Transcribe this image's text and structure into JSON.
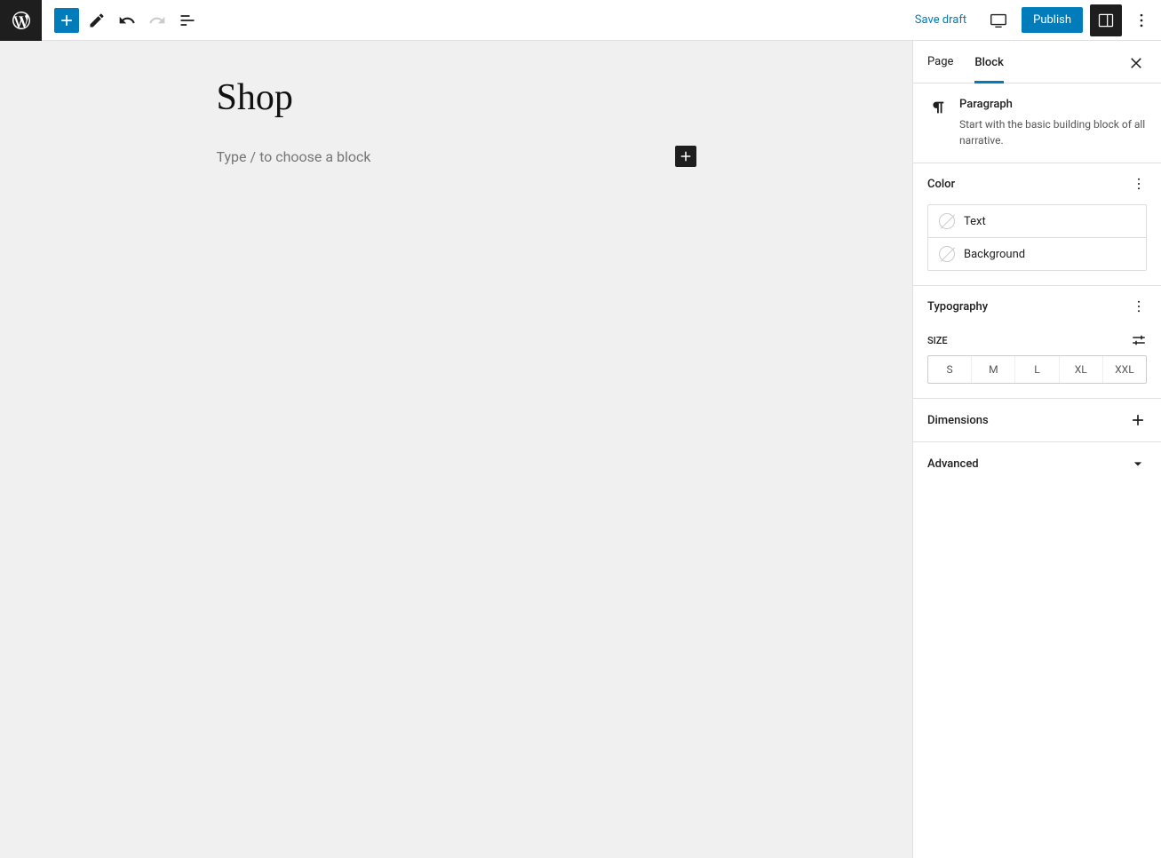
{
  "toolbar": {
    "save_draft": "Save draft",
    "publish": "Publish"
  },
  "editor": {
    "title": "Shop",
    "placeholder": "Type / to choose a block"
  },
  "sidebar": {
    "tabs": {
      "page": "Page",
      "block": "Block"
    },
    "block_info": {
      "title": "Paragraph",
      "description": "Start with the basic building block of all narrative."
    },
    "panels": {
      "color": {
        "title": "Color",
        "rows": {
          "text": "Text",
          "background": "Background"
        }
      },
      "typography": {
        "title": "Typography",
        "size_label": "Size",
        "sizes": [
          "S",
          "M",
          "L",
          "XL",
          "XXL"
        ]
      },
      "dimensions": {
        "title": "Dimensions"
      },
      "advanced": {
        "title": "Advanced"
      }
    }
  }
}
